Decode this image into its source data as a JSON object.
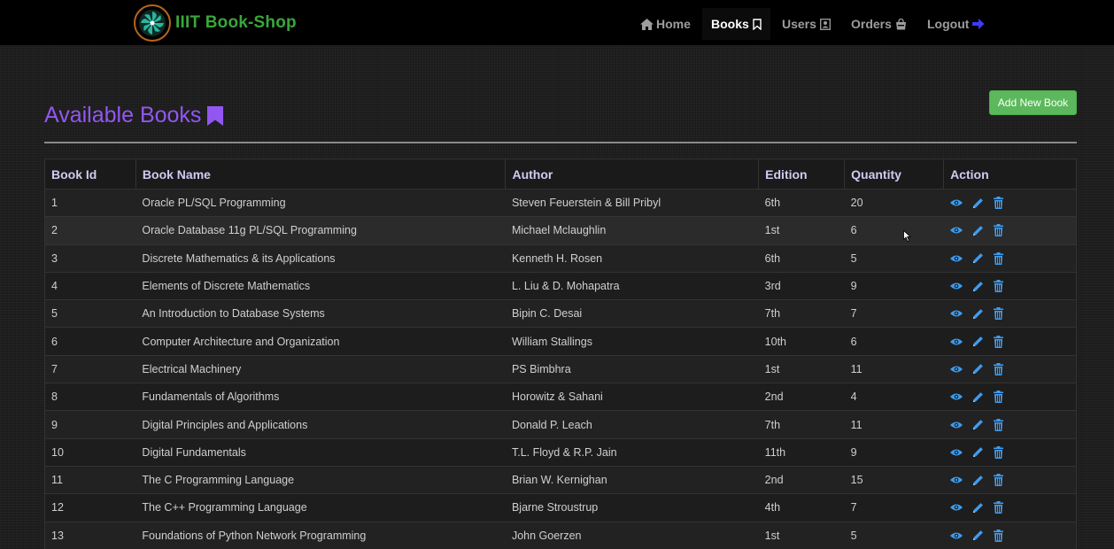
{
  "nav": {
    "brand": "IIIT Book-Shop",
    "items": [
      {
        "label": "Home"
      },
      {
        "label": "Books"
      },
      {
        "label": "Users"
      },
      {
        "label": "Orders"
      },
      {
        "label": "Logout"
      }
    ]
  },
  "page": {
    "title": "Available Books",
    "add_button": "Add New Book"
  },
  "table": {
    "headers": [
      "Book Id",
      "Book Name",
      "Author",
      "Edition",
      "Quantity",
      "Action"
    ],
    "rows": [
      {
        "id": "1",
        "name": "Oracle PL/SQL Programming",
        "author": "Steven Feuerstein & Bill Pribyl",
        "edition": "6th",
        "quantity": "20"
      },
      {
        "id": "2",
        "name": "Oracle Database 11g PL/SQL Programming",
        "author": "Michael Mclaughlin",
        "edition": "1st",
        "quantity": "6"
      },
      {
        "id": "3",
        "name": "Discrete Mathematics & its Applications",
        "author": "Kenneth H. Rosen",
        "edition": "6th",
        "quantity": "5"
      },
      {
        "id": "4",
        "name": "Elements of Discrete Mathematics",
        "author": "L. Liu & D. Mohapatra",
        "edition": "3rd",
        "quantity": "9"
      },
      {
        "id": "5",
        "name": "An Introduction to Database Systems",
        "author": "Bipin C. Desai",
        "edition": "7th",
        "quantity": "7"
      },
      {
        "id": "6",
        "name": "Computer Architecture and Organization",
        "author": "William Stallings",
        "edition": "10th",
        "quantity": "6"
      },
      {
        "id": "7",
        "name": "Electrical Machinery",
        "author": "PS Bimbhra",
        "edition": "1st",
        "quantity": "11"
      },
      {
        "id": "8",
        "name": "Fundamentals of Algorithms",
        "author": "Horowitz & Sahani",
        "edition": "2nd",
        "quantity": "4"
      },
      {
        "id": "9",
        "name": "Digital Principles and Applications",
        "author": "Donald P. Leach",
        "edition": "7th",
        "quantity": "11"
      },
      {
        "id": "10",
        "name": "Digital Fundamentals",
        "author": "T.L. Floyd & R.P. Jain",
        "edition": "11th",
        "quantity": "9"
      },
      {
        "id": "11",
        "name": "The C Programming Language",
        "author": "Brian W. Kernighan",
        "edition": "2nd",
        "quantity": "15"
      },
      {
        "id": "12",
        "name": "The C++ Programming Language",
        "author": "Bjarne Stroustrup",
        "edition": "4th",
        "quantity": "7"
      },
      {
        "id": "13",
        "name": "Foundations of Python Network Programming",
        "author": "John Goerzen",
        "edition": "1st",
        "quantity": "5"
      }
    ]
  },
  "icons": {
    "home": "home-icon",
    "books": "bookmark-outline-icon",
    "users": "contact-card-icon",
    "orders": "shopping-bag-icon",
    "logout": "sign-out-icon",
    "title": "bookmark-icon",
    "view": "eye-icon",
    "edit": "pencil-icon",
    "delete": "trash-icon"
  },
  "colors": {
    "brand": "#3aa63a",
    "title": "#9257f0",
    "add_button": "#5cb85c",
    "action_icons": "#3e9cf0",
    "logout_icon": "#3b3bff"
  }
}
